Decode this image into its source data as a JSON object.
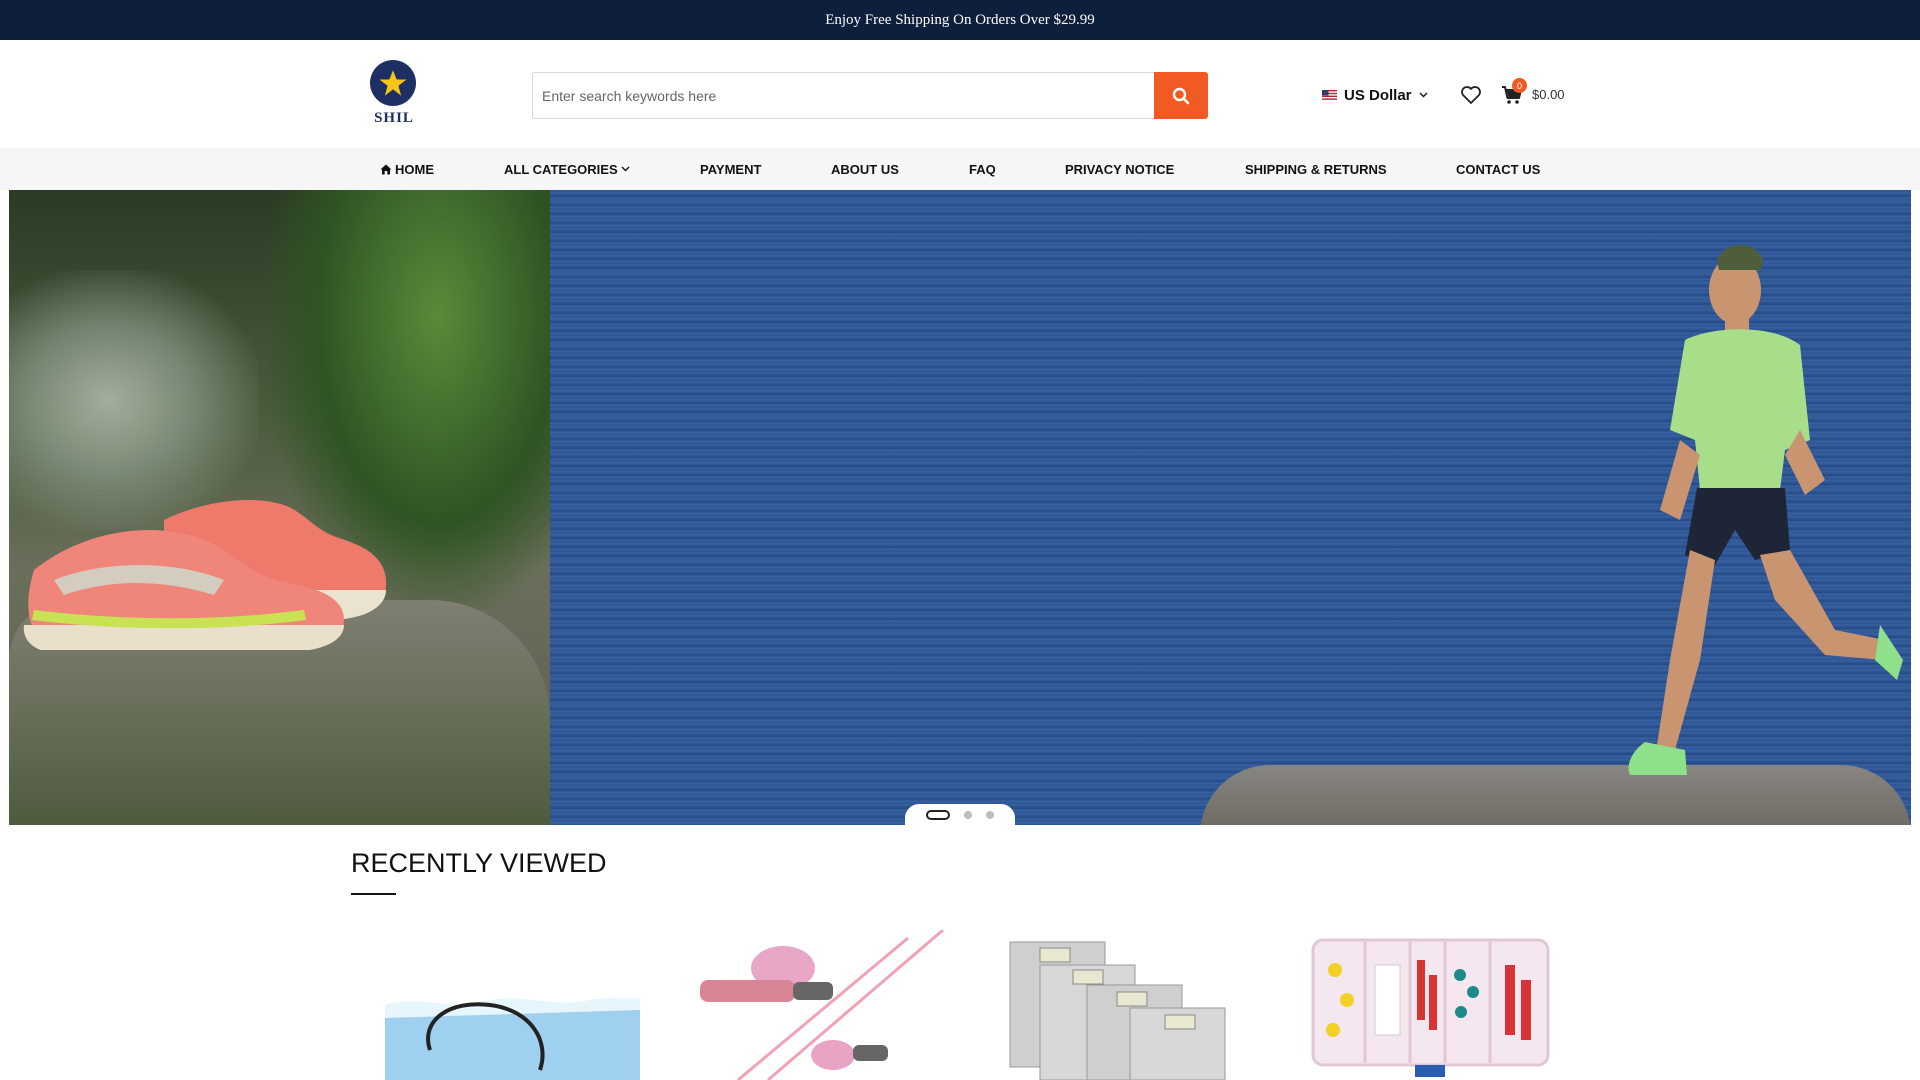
{
  "topbar": {
    "text": "Enjoy Free Shipping On Orders Over $29.99"
  },
  "logo": {
    "text": "SHIL"
  },
  "search": {
    "placeholder": "Enter search keywords here",
    "icon": "search-icon"
  },
  "currency": {
    "label": "US Dollar",
    "flag": "us-flag-icon"
  },
  "cart": {
    "count": "0",
    "total": "$0.00"
  },
  "nav": {
    "home": "HOME",
    "categories": "ALL CATEGORIES",
    "payment": "PAYMENT",
    "about": "ABOUT US",
    "faq": "FAQ",
    "privacy": "PRIVACY NOTICE",
    "shipping": "SHIPPING & RETURNS",
    "contact": "CONTACT US"
  },
  "hero": {
    "slides": 3,
    "active_slide": 1
  },
  "recently_viewed": {
    "title": "RECENTLY VIEWED"
  },
  "colors": {
    "topbar": "#0d1f3c",
    "accent": "#f15a22",
    "logo": "#1d2f63"
  }
}
